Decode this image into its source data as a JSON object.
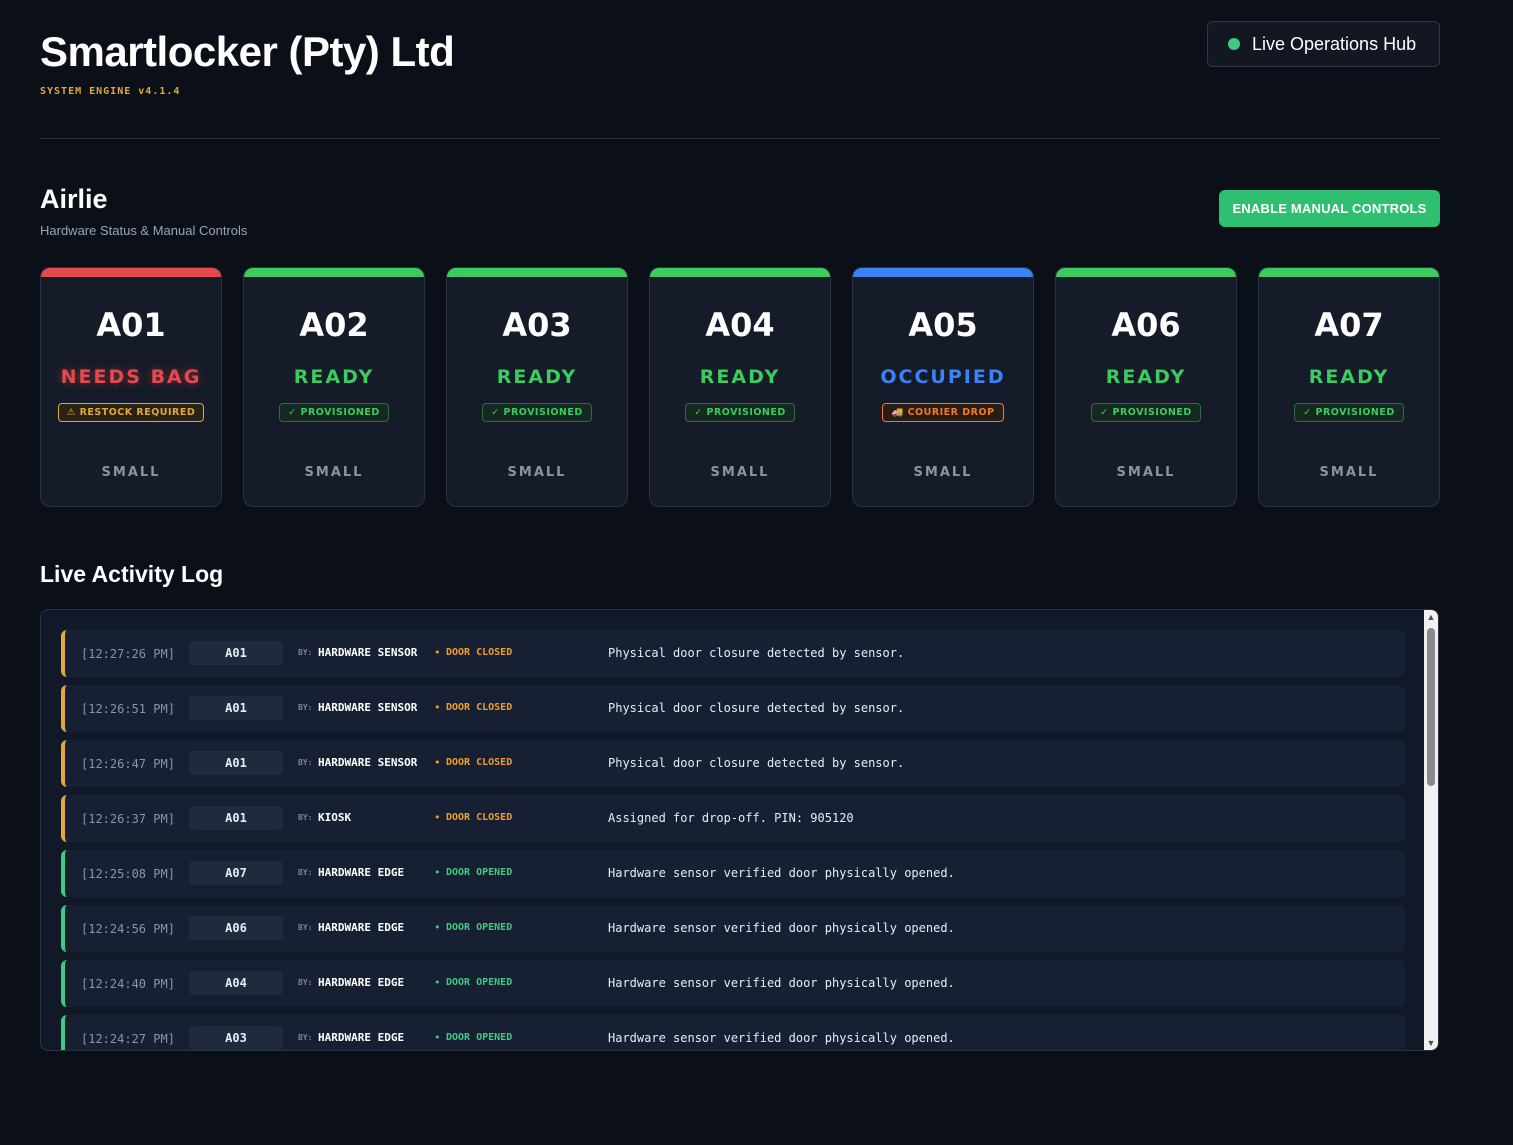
{
  "header": {
    "title": "Smartlocker (Pty) Ltd",
    "subtitle": "SYSTEM ENGINE v4.1.4",
    "live_label": "Live Operations Hub"
  },
  "site": {
    "name": "Airlie",
    "subtitle": "Hardware Status & Manual Controls",
    "manual_button": "ENABLE MANUAL CONTROLS"
  },
  "colors": {
    "red": "#e5484d",
    "green": "#3ccb5f",
    "blue": "#3b82f6",
    "amber": "#e0a93a",
    "orange": "#f07a2a"
  },
  "lockers": [
    {
      "code": "A01",
      "status": "NEEDS BAG",
      "badge": "⚠ RESTOCK REQUIRED",
      "size": "SMALL",
      "tone": "red"
    },
    {
      "code": "A02",
      "status": "READY",
      "badge": "✓ PROVISIONED",
      "size": "SMALL",
      "tone": "green"
    },
    {
      "code": "A03",
      "status": "READY",
      "badge": "✓ PROVISIONED",
      "size": "SMALL",
      "tone": "green"
    },
    {
      "code": "A04",
      "status": "READY",
      "badge": "✓ PROVISIONED",
      "size": "SMALL",
      "tone": "green"
    },
    {
      "code": "A05",
      "status": "OCCUPIED",
      "badge": "🚚 COURIER DROP",
      "size": "SMALL",
      "tone": "blue"
    },
    {
      "code": "A06",
      "status": "READY",
      "badge": "✓ PROVISIONED",
      "size": "SMALL",
      "tone": "green"
    },
    {
      "code": "A07",
      "status": "READY",
      "badge": "✓ PROVISIONED",
      "size": "SMALL",
      "tone": "green"
    }
  ],
  "log": {
    "title": "Live Activity Log",
    "by_prefix": "BY:",
    "rows": [
      {
        "time": "[12:27:26 PM]",
        "unit": "A01",
        "by": "HARDWARE SENSOR",
        "event": "DOOR CLOSED",
        "message": "Physical door closure detected by sensor.",
        "kind": "closed"
      },
      {
        "time": "[12:26:51 PM]",
        "unit": "A01",
        "by": "HARDWARE SENSOR",
        "event": "DOOR CLOSED",
        "message": "Physical door closure detected by sensor.",
        "kind": "closed"
      },
      {
        "time": "[12:26:47 PM]",
        "unit": "A01",
        "by": "HARDWARE SENSOR",
        "event": "DOOR CLOSED",
        "message": "Physical door closure detected by sensor.",
        "kind": "closed"
      },
      {
        "time": "[12:26:37 PM]",
        "unit": "A01",
        "by": "KIOSK",
        "event": "DOOR CLOSED",
        "message": "Assigned for drop-off. PIN: 905120",
        "kind": "closed"
      },
      {
        "time": "[12:25:08 PM]",
        "unit": "A07",
        "by": "HARDWARE EDGE",
        "event": "DOOR OPENED",
        "message": "Hardware sensor verified door physically opened.",
        "kind": "opened"
      },
      {
        "time": "[12:24:56 PM]",
        "unit": "A06",
        "by": "HARDWARE EDGE",
        "event": "DOOR OPENED",
        "message": "Hardware sensor verified door physically opened.",
        "kind": "opened"
      },
      {
        "time": "[12:24:40 PM]",
        "unit": "A04",
        "by": "HARDWARE EDGE",
        "event": "DOOR OPENED",
        "message": "Hardware sensor verified door physically opened.",
        "kind": "opened"
      },
      {
        "time": "[12:24:27 PM]",
        "unit": "A03",
        "by": "HARDWARE EDGE",
        "event": "DOOR OPENED",
        "message": "Hardware sensor verified door physically opened.",
        "kind": "opened"
      }
    ]
  }
}
